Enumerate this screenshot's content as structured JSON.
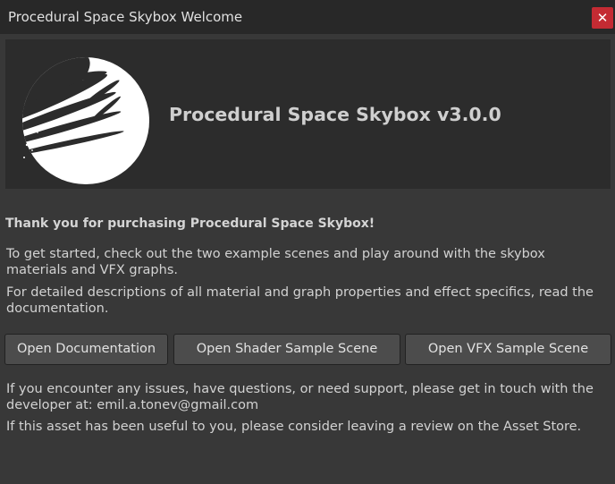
{
  "window": {
    "title": "Procedural Space Skybox Welcome",
    "close_glyph": "✕",
    "close_icon": "close-icon"
  },
  "header": {
    "logo_icon": "planet-logo-icon",
    "title": "Procedural Space Skybox v3.0.0"
  },
  "intro": {
    "thanks": "Thank you for purchasing Procedural Space Skybox!",
    "getting_started": "To get started, check out the two example scenes and play around with the skybox materials and VFX graphs.",
    "details": "For detailed descriptions of all material and graph properties and effect specifics, read the documentation."
  },
  "buttons": {
    "documentation": "Open Documentation",
    "shader_scene": "Open Shader Sample Scene",
    "vfx_scene": "Open VFX Sample Scene"
  },
  "footer": {
    "support": "If you encounter any issues, have questions, or need support, please get in touch with the developer at: emil.a.tonev@gmail.com",
    "review": "If this asset has been useful to you, please consider leaving a review on the Asset Store."
  },
  "colors": {
    "background": "#383838",
    "titlebar": "#282828",
    "header_panel": "#2c2c2c",
    "button": "#4c4c4c",
    "close": "#c42b33"
  }
}
